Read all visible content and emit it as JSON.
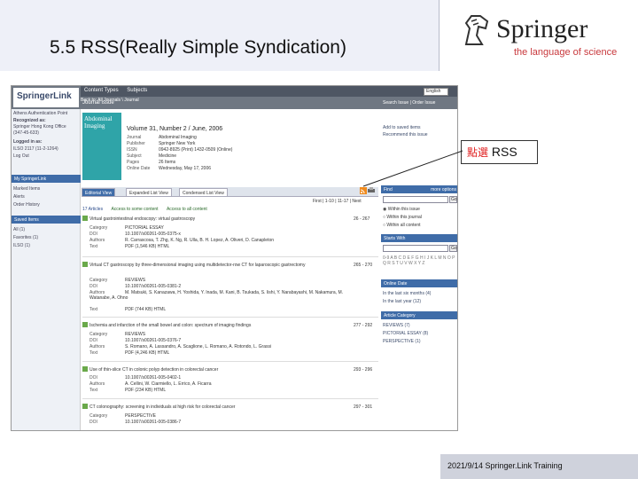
{
  "slide": {
    "title": "5.5 RSS(Really Simple Syndication)",
    "logo_name": "Springer",
    "logo_tagline": "the language of science",
    "callout": {
      "highlight": "點選",
      "text": "RSS"
    },
    "footer": "2021/9/14 Springer.Link Training"
  },
  "screenshot": {
    "logo": "SpringerLink",
    "nav": [
      "Content Types",
      "Subjects"
    ],
    "breadcrumb": "Back to: All Journals \\ Journal",
    "language": "English",
    "sidebar": {
      "lines": [
        "Athens Authentication Point",
        "Recognized as:",
        "Springer Hong Kong Office",
        "(347-45-633)",
        "Logged in as:",
        "ILSO 2117 (11-2-1264)",
        "Log Out"
      ],
      "my_springerlink": "My SpringerLink",
      "my_items": [
        "Marked Items",
        "Alerts",
        "Order History"
      ],
      "saved_items_head": "Saved Items",
      "saved_items": [
        "All (1)",
        "Favorites (1)",
        "ILSO (1)"
      ]
    },
    "journal_issue": "Journal Issue",
    "cover_text": "Abdominal Imaging",
    "issue_title": "Volume 31, Number 2 / June, 2006",
    "meta": [
      {
        "label": "Journal",
        "value": "Abdominal Imaging"
      },
      {
        "label": "Publisher",
        "value": "Springer New York"
      },
      {
        "label": "ISSN",
        "value": "0942-8925 (Print) 1432-0509 (Online)"
      },
      {
        "label": "Subject",
        "value": "Medicine"
      },
      {
        "label": "Pages",
        "value": "26 Items"
      },
      {
        "label": "Online Date",
        "value": "Wednesday, May 17, 2006"
      }
    ],
    "tabs": [
      "Editorial View",
      "Expanded List View",
      "Condensed List View"
    ],
    "pager": "First | 1-10 | 11-17 | Next",
    "select_all": "17 Articles",
    "select_all_check": "Access to some content",
    "access_all_check": "Access to all content",
    "articles": [
      {
        "title": "Virtual gastrointestinal endoscopy: virtual gastroscopy",
        "pages": "26 - 267",
        "rows": [
          {
            "label": "Category",
            "value": "PICTORIAL ESSAY"
          },
          {
            "label": "DOI",
            "value": "10.1007/s00261-005-0375-x"
          },
          {
            "label": "Authors",
            "value": "R. Carrascosa, T. Zhg, K. Ng, R. Ulla, B. H. Lopez, A. Oliveri, D. Canapleton"
          },
          {
            "label": "Text",
            "value": "PDF (1,546 KB) HTML"
          }
        ]
      },
      {
        "title": "Virtual CT gastroscopy by three-dimensional imaging using multidetector-row CT for laparoscopic gastrectomy",
        "pages": "265 - 270",
        "rows": [
          {
            "label": "Category",
            "value": "REVIEWS"
          },
          {
            "label": "DOI",
            "value": "10.1007/s00261-005-0381-2"
          },
          {
            "label": "Authors",
            "value": "M. Matsuki, S. Kanazawa, H. Yoshida, Y. Inada, M. Kani, B. Tsukada, S. Iishi, Y. Narabayashi, M. Nakamura, M. Watanabe, A. Ohno"
          },
          {
            "label": "Text",
            "value": "PDF (744 KB) HTML"
          }
        ]
      },
      {
        "title": "Ischemia and infarction of the small bowel and colon: spectrum of imaging findings",
        "pages": "277 - 292",
        "rows": [
          {
            "label": "Category",
            "value": "REVIEWS"
          },
          {
            "label": "DOI",
            "value": "10.1007/s00261-005-0376-7"
          },
          {
            "label": "Authors",
            "value": "S. Romano, A. Lassandro, A. Scaglione, L. Romano, A. Rotondo, L. Grassi"
          },
          {
            "label": "Text",
            "value": "PDF (4,246 KB) HTML"
          }
        ]
      },
      {
        "title": "Use of thin-slice CT in colonic polyp detection in colorectal cancer",
        "pages": "293 - 296",
        "rows": [
          {
            "label": "DOI",
            "value": "10.1007/s00261-005-0402-1"
          },
          {
            "label": "Authors",
            "value": "A. Cellini, W. Ciarmiello, L. Errico, A. Ficarra"
          },
          {
            "label": "Text",
            "value": "PDF (234 KB) HTML"
          }
        ]
      },
      {
        "title": "CT colonography: screening in individuals at high risk for colorectal cancer",
        "pages": "297 - 301",
        "rows": [
          {
            "label": "Category",
            "value": "PERSPECTIVE"
          },
          {
            "label": "DOI",
            "value": "10.1007/s00261-005-0386-7"
          }
        ]
      }
    ],
    "right": {
      "links": [
        "Add to saved items",
        "Recommend this issue"
      ],
      "top_links": [
        "Search Issue",
        "Order Issue"
      ],
      "find_head": "Find",
      "more_options": "more options",
      "radios": [
        "Within this issue",
        "Within this journal",
        "Within all content"
      ],
      "starts_with_head": "Starts With",
      "letters": "0-9 A B C D E F G H I J K L M N O P Q R S T U V W X Y Z",
      "online_date_head": "Online Date",
      "online_dates": [
        "In the last six months (4)",
        "In the last year (12)"
      ],
      "article_category_head": "Article Category",
      "categories": [
        "REVIEWS (7)",
        "PICTORIAL ESSAY (8)",
        "PERSPECTIVE (1)"
      ]
    }
  }
}
